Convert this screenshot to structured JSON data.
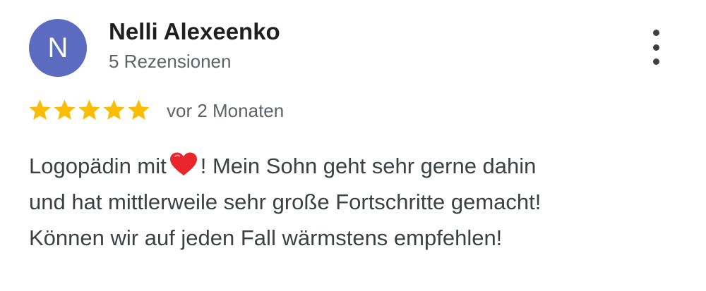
{
  "review": {
    "avatar_letter": "N",
    "avatar_color": "#5c6bc0",
    "author_name": "Nelli Alexeenko",
    "review_count": "5 Rezensionen",
    "rating": 5,
    "rating_max": 5,
    "star_color": "#fbbc04",
    "time_ago": "vor 2 Monaten",
    "text": {
      "line1_before_heart": "Logopädin mit",
      "heart_icon": "red-heart-emoji",
      "line1_after_heart": "! Mein Sohn geht sehr gerne dahin",
      "line2": "und hat mittlerweile sehr große Fortschritte gemacht!",
      "line3": "Können wir auf jeden Fall wärmstens empfehlen!"
    },
    "menu_icon": "more-vert-icon"
  }
}
